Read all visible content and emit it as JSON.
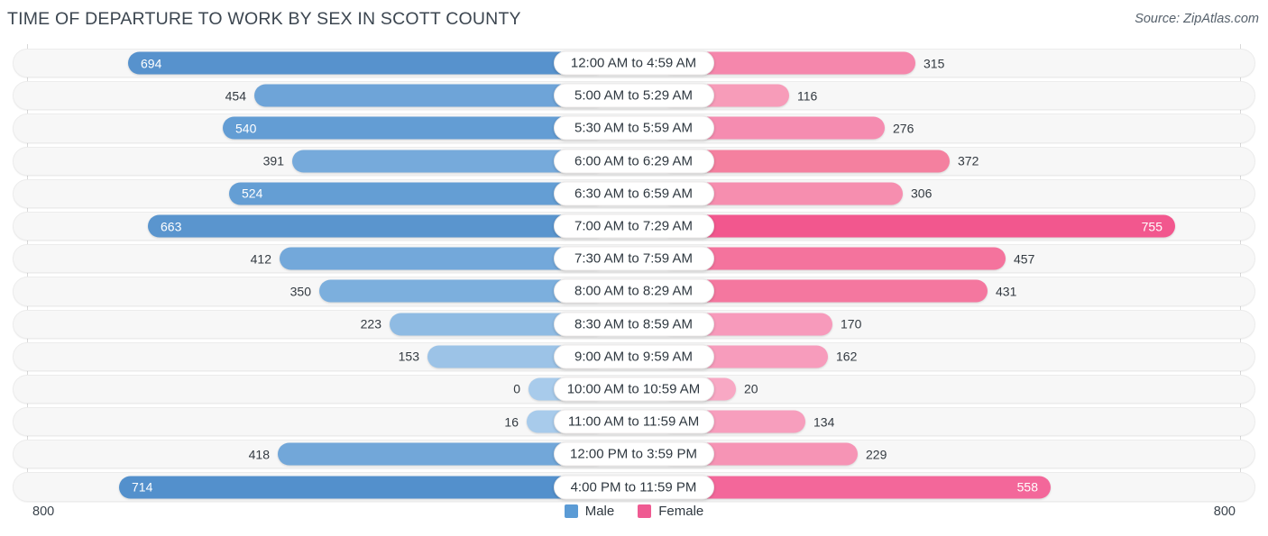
{
  "header": {
    "title": "TIME OF DEPARTURE TO WORK BY SEX IN SCOTT COUNTY",
    "source": "Source: ZipAtlas.com"
  },
  "footer": {
    "scale_left": "800",
    "scale_right": "800",
    "legend": [
      {
        "label": "Male",
        "color": "#5b9bd5",
        "icon": "square-swatch"
      },
      {
        "label": "Female",
        "color": "#ef5b92",
        "icon": "square-swatch"
      }
    ]
  },
  "chart_data": {
    "type": "bar",
    "orientation": "horizontal-diverging",
    "title": "TIME OF DEPARTURE TO WORK BY SEX IN SCOTT COUNTY",
    "xlabel": "",
    "ylabel": "",
    "xlim": [
      800,
      800
    ],
    "axis_max": 800,
    "grid": false,
    "legend_position": "bottom-center",
    "categories": [
      "12:00 AM to 4:59 AM",
      "5:00 AM to 5:29 AM",
      "5:30 AM to 5:59 AM",
      "6:00 AM to 6:29 AM",
      "6:30 AM to 6:59 AM",
      "7:00 AM to 7:29 AM",
      "7:30 AM to 7:59 AM",
      "8:00 AM to 8:29 AM",
      "8:30 AM to 8:59 AM",
      "9:00 AM to 9:59 AM",
      "10:00 AM to 10:59 AM",
      "11:00 AM to 11:59 AM",
      "12:00 PM to 3:59 PM",
      "4:00 PM to 11:59 PM"
    ],
    "series": [
      {
        "name": "Male",
        "color": "#5b9bd5",
        "side": "left",
        "values": [
          694,
          454,
          540,
          391,
          524,
          663,
          412,
          350,
          223,
          153,
          0,
          16,
          418,
          714
        ]
      },
      {
        "name": "Female",
        "color": "#ef5b92",
        "side": "right",
        "values": [
          315,
          116,
          276,
          372,
          306,
          755,
          457,
          431,
          170,
          162,
          20,
          134,
          229,
          558
        ]
      }
    ]
  },
  "rows": [
    {
      "label": "12:00 AM to 4:59 AM",
      "male": "694",
      "female": "315",
      "male_len": 530,
      "female_len": 282,
      "male_color": "#5792cd",
      "female_color": "#f587ac",
      "male_inside": true,
      "female_inside": false
    },
    {
      "label": "5:00 AM to 5:29 AM",
      "male": "454",
      "female": "116",
      "male_len": 390,
      "female_len": 142,
      "male_color": "#6ea4d8",
      "female_color": "#f79cb9",
      "male_inside": false,
      "female_inside": false
    },
    {
      "label": "5:30 AM to 5:59 AM",
      "male": "540",
      "female": "276",
      "male_len": 425,
      "female_len": 248,
      "male_color": "#639dd4",
      "female_color": "#f58cb0",
      "male_inside": true,
      "female_inside": false
    },
    {
      "label": "6:00 AM to 6:29 AM",
      "male": "391",
      "female": "372",
      "male_len": 348,
      "female_len": 320,
      "male_color": "#76aadb",
      "female_color": "#f4809f",
      "male_inside": false,
      "female_inside": false
    },
    {
      "label": "6:30 AM to 6:59 AM",
      "male": "524",
      "female": "306",
      "male_len": 418,
      "female_len": 268,
      "male_color": "#649ed4",
      "female_color": "#f68eaf",
      "male_inside": true,
      "female_inside": false
    },
    {
      "label": "7:00 AM to 7:29 AM",
      "male": "663",
      "female": "755",
      "male_len": 508,
      "female_len": 570,
      "male_color": "#5a95ce",
      "female_color": "#f2578e",
      "male_inside": true,
      "female_inside": true
    },
    {
      "label": "7:30 AM to 7:59 AM",
      "male": "412",
      "female": "457",
      "male_len": 362,
      "female_len": 382,
      "male_color": "#73a8da",
      "female_color": "#f4739d",
      "male_inside": false,
      "female_inside": false
    },
    {
      "label": "8:00 AM to 8:29 AM",
      "male": "350",
      "female": "431",
      "male_len": 318,
      "female_len": 362,
      "male_color": "#7cafdd",
      "female_color": "#f4779f",
      "male_inside": false,
      "female_inside": false
    },
    {
      "label": "8:30 AM to 8:59 AM",
      "male": "223",
      "female": "170",
      "male_len": 240,
      "female_len": 190,
      "male_color": "#8fbbe3",
      "female_color": "#f79abb",
      "male_inside": false,
      "female_inside": false
    },
    {
      "label": "9:00 AM to 9:59 AM",
      "male": "153",
      "female": "162",
      "male_len": 198,
      "female_len": 185,
      "male_color": "#9cc3e7",
      "female_color": "#f79cbc",
      "male_inside": false,
      "female_inside": false
    },
    {
      "label": "10:00 AM to 10:59 AM",
      "male": "0",
      "female": "20",
      "male_len": 86,
      "female_len": 83,
      "male_color": "#a8cbeb",
      "female_color": "#f8a8c4",
      "male_inside": false,
      "female_inside": false
    },
    {
      "label": "11:00 AM to 11:59 AM",
      "male": "16",
      "female": "134",
      "male_len": 88,
      "female_len": 160,
      "male_color": "#a8cbeb",
      "female_color": "#f79ebd",
      "male_inside": false,
      "female_inside": false
    },
    {
      "label": "12:00 PM to 3:59 PM",
      "male": "418",
      "female": "229",
      "male_len": 364,
      "female_len": 218,
      "male_color": "#72a7d9",
      "female_color": "#f694b5",
      "male_inside": false,
      "female_inside": false
    },
    {
      "label": "4:00 PM to 11:59 PM",
      "male": "714",
      "female": "558",
      "male_len": 540,
      "female_len": 432,
      "male_color": "#5390cc",
      "female_color": "#f3679a",
      "male_inside": true,
      "female_inside": true
    }
  ]
}
